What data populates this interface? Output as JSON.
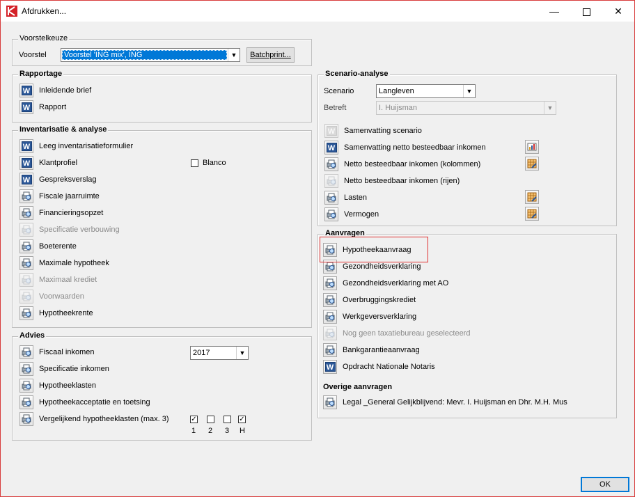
{
  "window": {
    "title": "Afdrukken..."
  },
  "voorstelkeuze": {
    "legend": "Voorstelkeuze",
    "label": "Voorstel",
    "value": "Voorstel 'ING mix', ING",
    "batch_label": "Batchprint..."
  },
  "rapportage": {
    "legend": "Rapportage",
    "items": [
      {
        "label": "Inleidende brief",
        "icon": "word-icon"
      },
      {
        "label": "Rapport",
        "icon": "word-icon"
      }
    ]
  },
  "inventarisatie": {
    "legend": "Inventarisatie & analyse",
    "blanco_label": "Blanco",
    "items": [
      {
        "label": "Leeg inventarisatieformulier",
        "icon": "word-icon"
      },
      {
        "label": "Klantprofiel",
        "icon": "word-icon"
      },
      {
        "label": "Gespreksverslag",
        "icon": "word-icon"
      },
      {
        "label": "Fiscale jaarruimte",
        "icon": "print-preview-icon"
      },
      {
        "label": "Financieringsopzet",
        "icon": "print-preview-icon"
      },
      {
        "label": "Specificatie verbouwing",
        "icon": "print-preview-icon",
        "disabled": true
      },
      {
        "label": "Boeterente",
        "icon": "print-preview-icon"
      },
      {
        "label": "Maximale hypotheek",
        "icon": "print-preview-icon"
      },
      {
        "label": "Maximaal krediet",
        "icon": "print-preview-icon",
        "disabled": true
      },
      {
        "label": "Voorwaarden",
        "icon": "print-preview-icon",
        "disabled": true
      },
      {
        "label": "Hypotheekrente",
        "icon": "print-preview-icon"
      }
    ]
  },
  "advies": {
    "legend": "Advies",
    "year_value": "2017",
    "items": [
      {
        "label": "Fiscaal inkomen"
      },
      {
        "label": "Specificatie inkomen"
      },
      {
        "label": "Hypotheeklasten"
      },
      {
        "label": "Hypotheekacceptatie en toetsing"
      },
      {
        "label": "Vergelijkend hypotheeklasten (max. 3)"
      }
    ],
    "compare": [
      {
        "label": "1",
        "checked": true
      },
      {
        "label": "2",
        "checked": false
      },
      {
        "label": "3",
        "checked": false
      },
      {
        "label": "H",
        "checked": true
      }
    ]
  },
  "scenario": {
    "legend": "Scenario-analyse",
    "scenario_label": "Scenario",
    "scenario_value": "Langleven",
    "betreft_label": "Betreft",
    "betreft_value": "I. Huijsman",
    "items": [
      {
        "label": "Samenvatting scenario",
        "icon": "word-icon",
        "disabled_icon": true
      },
      {
        "label": "Samenvatting netto besteedbaar inkomen",
        "icon": "word-icon"
      },
      {
        "label": "Netto besteedbaar inkomen (kolommen)",
        "icon": "print-preview-icon"
      },
      {
        "label": "Netto besteedbaar inkomen (rijen)",
        "icon": "print-preview-icon",
        "disabled_icon": true
      },
      {
        "label": "Lasten",
        "icon": "print-preview-icon"
      },
      {
        "label": "Vermogen",
        "icon": "print-preview-icon"
      }
    ]
  },
  "aanvragen": {
    "legend": "Aanvragen",
    "items": [
      {
        "label": "Hypotheekaanvraag",
        "icon": "print-preview-icon"
      },
      {
        "label": "Gezondheidsverklaring",
        "icon": "print-preview-icon"
      },
      {
        "label": "Gezondheidsverklaring met AO",
        "icon": "print-preview-icon"
      },
      {
        "label": "Overbruggingskrediet",
        "icon": "print-preview-icon"
      },
      {
        "label": "Werkgeversverklaring",
        "icon": "print-preview-icon"
      },
      {
        "label": "Nog geen taxatiebureau geselecteerd",
        "icon": "print-preview-icon",
        "disabled": true
      },
      {
        "label": "Bankgarantieaanvraag",
        "icon": "print-preview-icon"
      },
      {
        "label": "Opdracht Nationale Notaris",
        "icon": "word-icon"
      }
    ],
    "overige_heading": "Overige aanvragen",
    "overige_items": [
      {
        "label": "Legal _General Gelijkblijvend: Mevr. I. Huijsman en Dhr. M.H. Mus",
        "icon": "print-preview-icon"
      }
    ]
  },
  "footer": {
    "ok_label": "OK"
  }
}
